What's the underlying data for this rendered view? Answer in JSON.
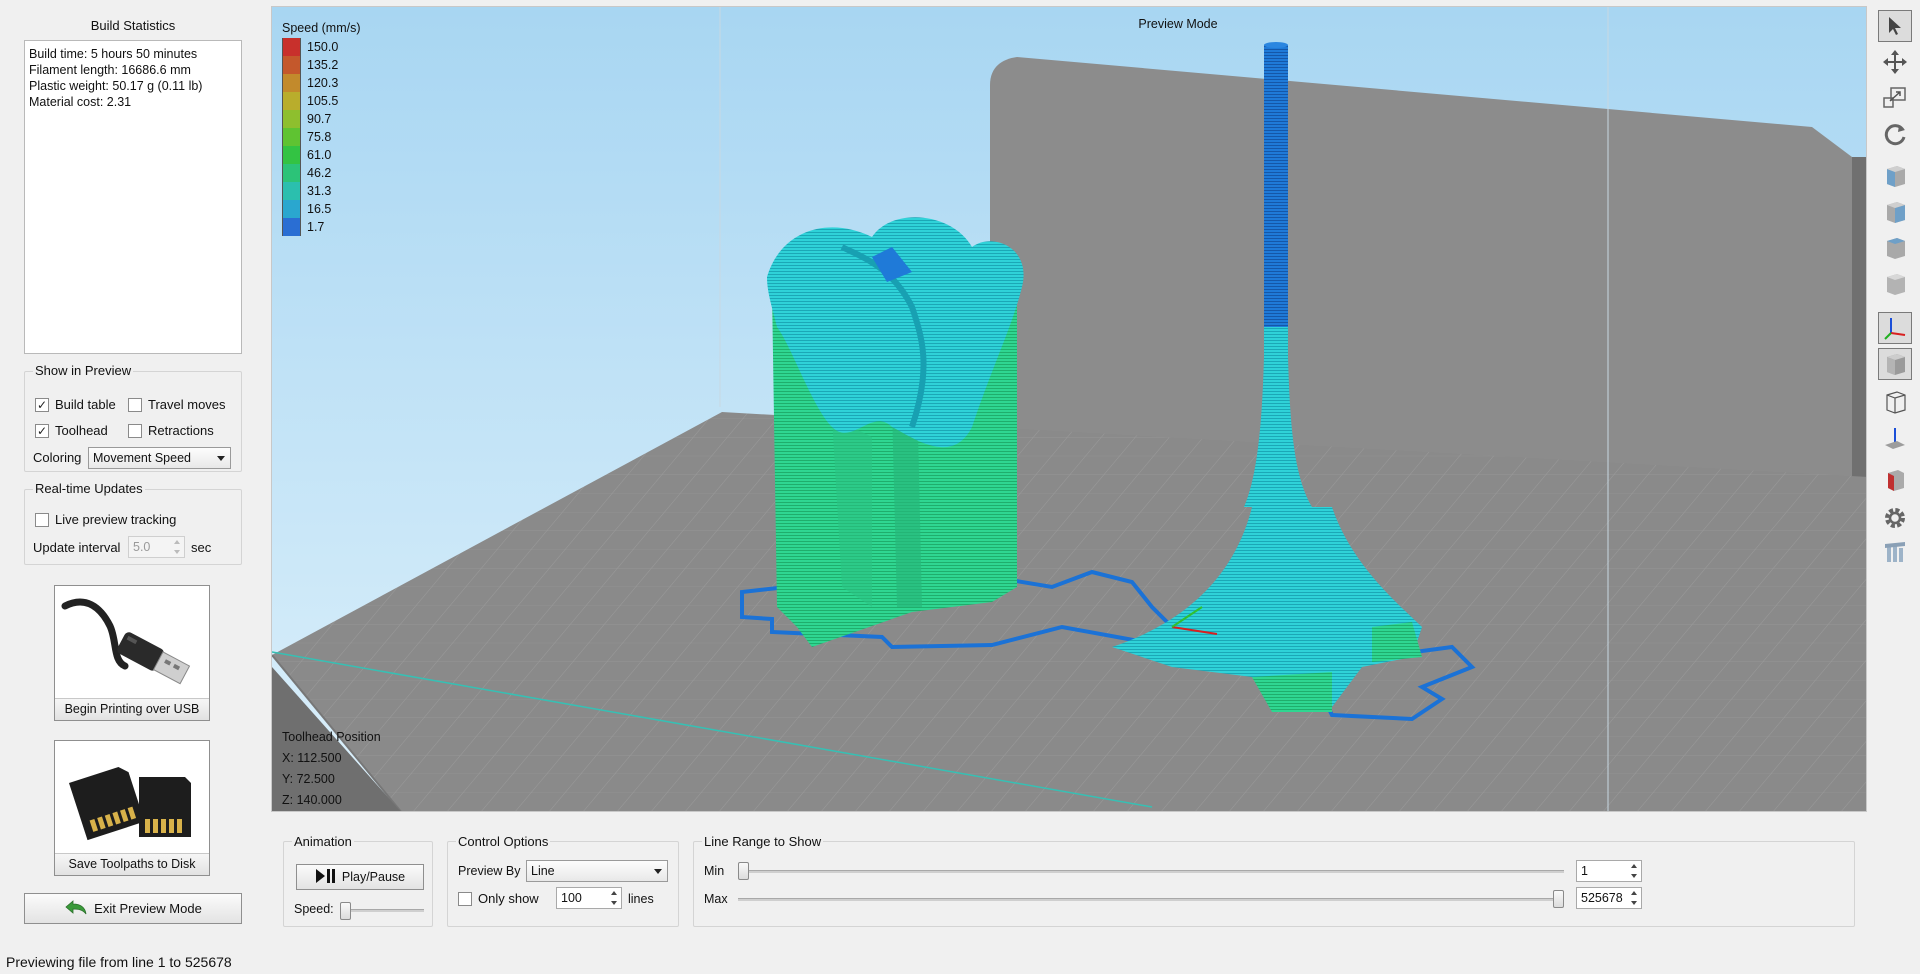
{
  "build_statistics": {
    "title": "Build Statistics",
    "lines": [
      "Build time: 5 hours 50 minutes",
      "Filament length: 16686.6 mm",
      "Plastic weight: 50.17 g (0.11 lb)",
      "Material cost: 2.31"
    ]
  },
  "show_in_preview": {
    "title": "Show in Preview",
    "build_table": {
      "label": "Build table",
      "checked": true
    },
    "travel_moves": {
      "label": "Travel moves",
      "checked": false
    },
    "toolhead": {
      "label": "Toolhead",
      "checked": true
    },
    "retractions": {
      "label": "Retractions",
      "checked": false
    },
    "coloring_label": "Coloring",
    "coloring_value": "Movement Speed"
  },
  "realtime_updates": {
    "title": "Real-time Updates",
    "live_tracking": {
      "label": "Live preview tracking",
      "checked": false
    },
    "interval_label": "Update interval",
    "interval_value": "5.0",
    "interval_unit": "sec"
  },
  "actions": {
    "usb_label": "Begin Printing over USB",
    "disk_label": "Save Toolpaths to Disk",
    "exit_label": "Exit Preview Mode"
  },
  "viewport": {
    "mode_label": "Preview Mode",
    "legend_title": "Speed (mm/s)",
    "legend": [
      {
        "value": "150.0",
        "color": "#c8302c"
      },
      {
        "value": "135.2",
        "color": "#c4582c"
      },
      {
        "value": "120.3",
        "color": "#c28a2c"
      },
      {
        "value": "105.5",
        "color": "#b9ad2c"
      },
      {
        "value": "90.7",
        "color": "#8ebf2e"
      },
      {
        "value": "75.8",
        "color": "#5fc332"
      },
      {
        "value": "61.0",
        "color": "#33c343"
      },
      {
        "value": "46.2",
        "color": "#2cc378"
      },
      {
        "value": "31.3",
        "color": "#2bbfae"
      },
      {
        "value": "16.5",
        "color": "#2aa7cf"
      },
      {
        "value": "1.7",
        "color": "#2a6ed3"
      }
    ],
    "toolhead_title": "Toolhead Position",
    "x": "X: 112.500",
    "y": "Y: 72.500",
    "z": "Z: 140.000"
  },
  "toolbar": {
    "icons": [
      "select-arrow-icon",
      "move-icon",
      "scale-icon",
      "rotate-icon",
      "view-front-cube-icon",
      "view-side-cube-icon",
      "view-top-cube-icon",
      "view-iso-cube-icon",
      "axes-icon",
      "solid-cube-icon",
      "wireframe-cube-icon",
      "lay-flat-icon",
      "cut-icon",
      "settings-gear-icon",
      "supports-icon"
    ]
  },
  "animation": {
    "title": "Animation",
    "play_label": "Play/Pause",
    "speed_label": "Speed:"
  },
  "control_options": {
    "title": "Control Options",
    "preview_by_label": "Preview By",
    "preview_by_value": "Line",
    "only_show_label": "Only show",
    "only_show_checked": false,
    "only_show_value": "100",
    "lines_label": "lines"
  },
  "line_range": {
    "title": "Line Range to Show",
    "min_label": "Min",
    "min_value": "1",
    "max_label": "Max",
    "max_value": "525678"
  },
  "status_bar": "Previewing file from line 1 to 525678"
}
